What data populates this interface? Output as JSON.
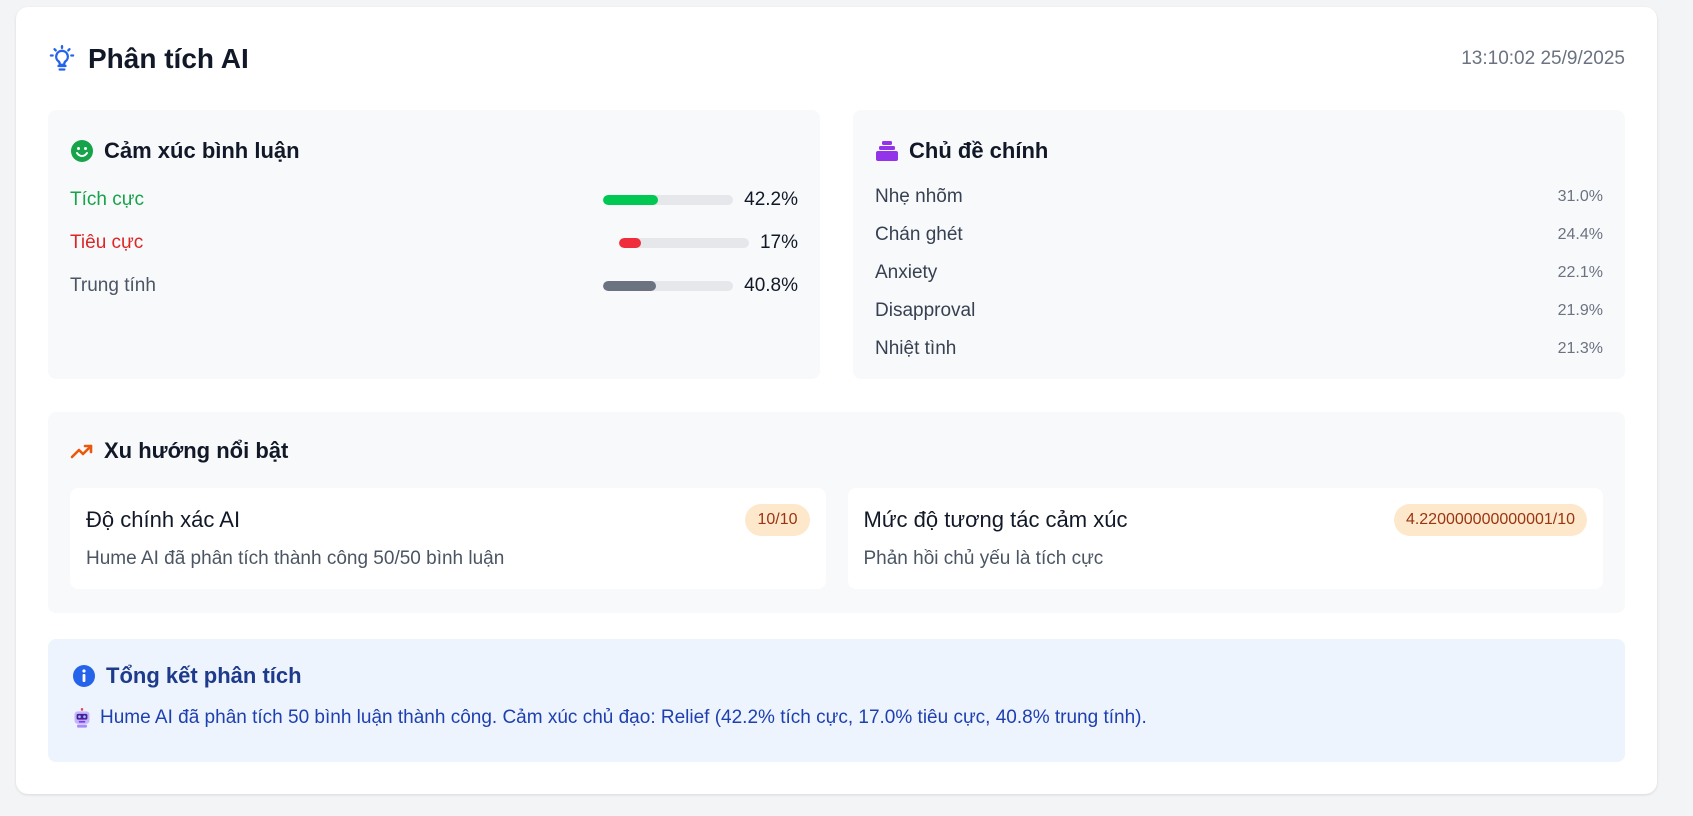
{
  "header": {
    "icon": "lightbulb-icon",
    "title": "Phân tích AI",
    "timestamp": "13:10:02 25/9/2025"
  },
  "sentiment": {
    "title": "Cảm xúc bình luận",
    "icon": "smile-icon",
    "items": [
      {
        "label": "Tích cực",
        "value": "42.2%",
        "fraction": 0.422,
        "color": "#16a34a",
        "bar_color": "#00c853"
      },
      {
        "label": "Tiêu cực",
        "value": "17%",
        "fraction": 0.17,
        "color": "#dc2626",
        "bar_color": "#ef2d3c"
      },
      {
        "label": "Trung tính",
        "value": "40.8%",
        "fraction": 0.408,
        "color": "#4b5563",
        "bar_color": "#6b7280"
      }
    ]
  },
  "topics": {
    "title": "Chủ đề chính",
    "icon": "stack-icon",
    "items": [
      {
        "label": "Nhẹ nhõm",
        "value": "31.0%"
      },
      {
        "label": "Chán ghét",
        "value": "24.4%"
      },
      {
        "label": "Anxiety",
        "value": "22.1%"
      },
      {
        "label": "Disapproval",
        "value": "21.9%"
      },
      {
        "label": "Nhiệt tình",
        "value": "21.3%"
      }
    ]
  },
  "trends": {
    "title": "Xu hướng nổi bật",
    "icon": "trending-up-icon",
    "cards": [
      {
        "name": "Độ chính xác AI",
        "badge": "10/10",
        "desc": "Hume AI đã phân tích thành công 50/50 bình luận"
      },
      {
        "name": "Mức độ tương tác cảm xúc",
        "badge": "4.220000000000001/10",
        "desc": "Phản hồi chủ yếu là tích cực"
      }
    ]
  },
  "summary": {
    "title": "Tổng kết phân tích",
    "icon": "info-icon",
    "text_icon": "robot-icon",
    "text": "Hume AI đã phân tích 50 bình luận thành công. Cảm xúc chủ đạo: Relief (42.2% tích cực, 17.0% tiêu cực, 40.8% trung tính)."
  },
  "colors": {
    "accent_blue": "#2563eb",
    "green": "#16a34a",
    "purple": "#9333ea",
    "orange": "#ea580c"
  }
}
